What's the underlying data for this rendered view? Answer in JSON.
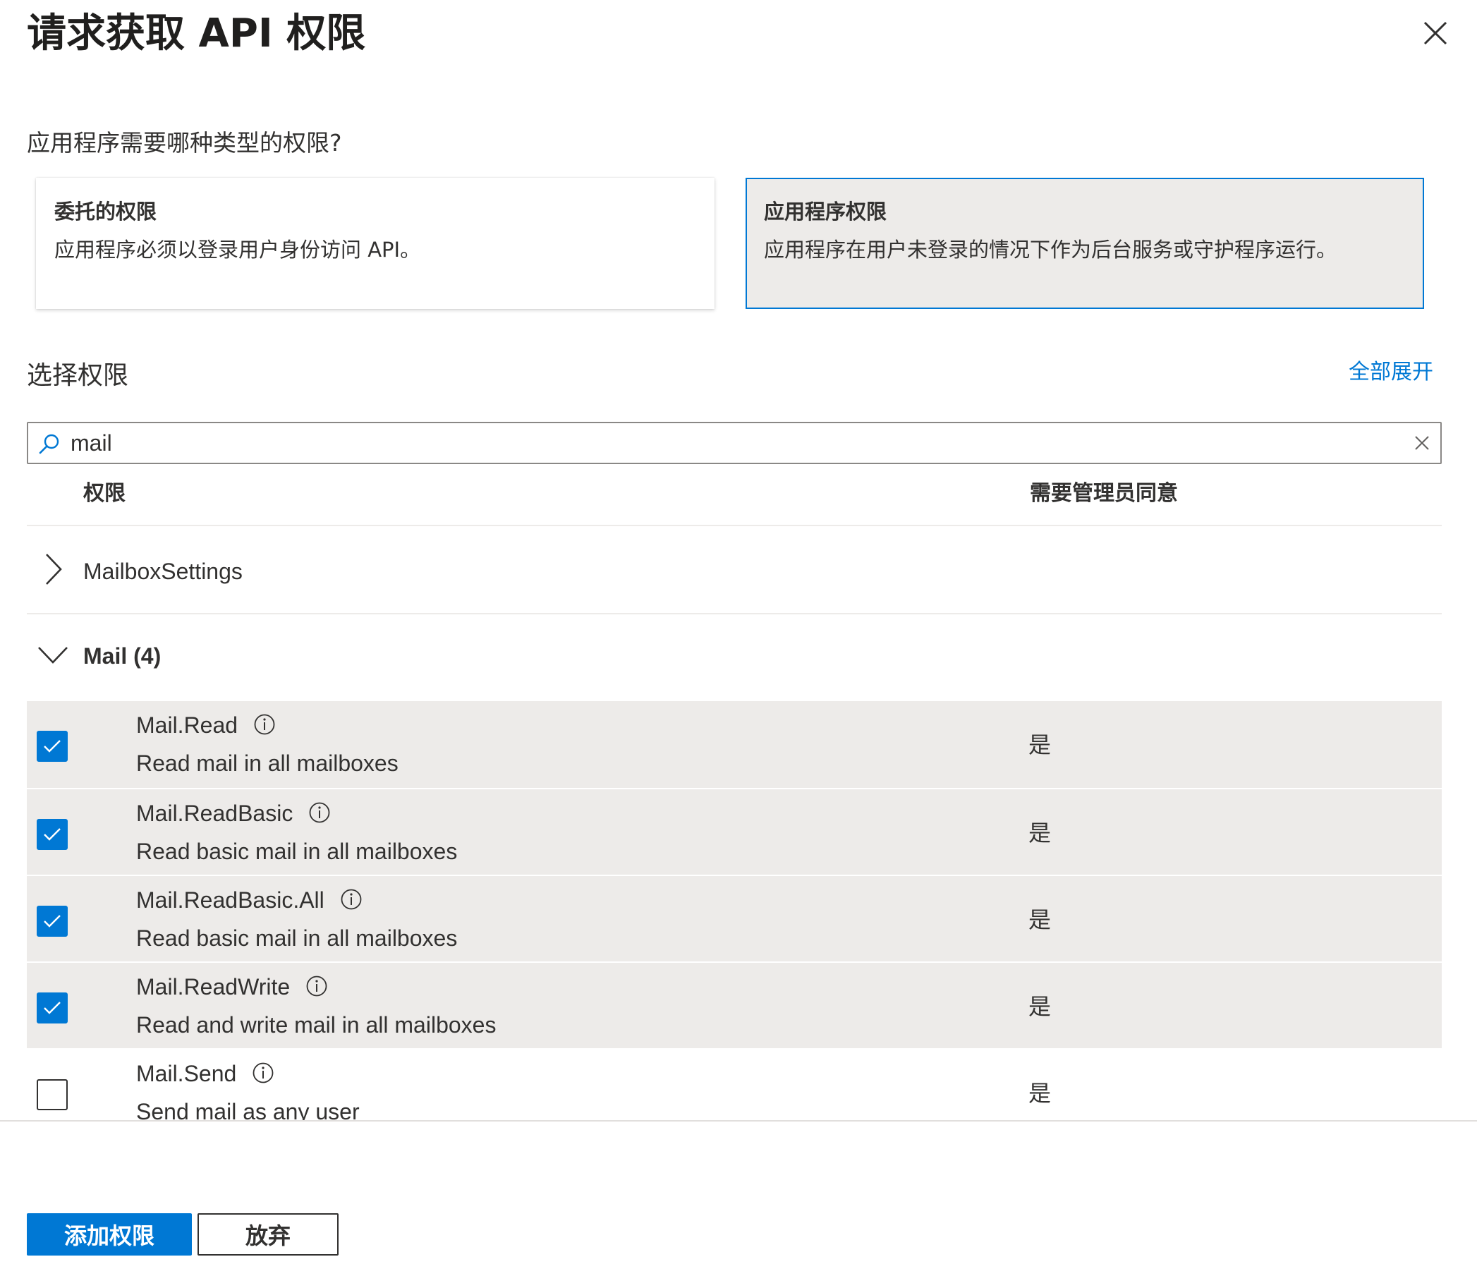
{
  "header": {
    "title": "请求获取 API 权限",
    "close_icon": "close-icon"
  },
  "question": "应用程序需要哪种类型的权限?",
  "permission_types": [
    {
      "title": "委托的权限",
      "description": "应用程序必须以登录用户身份访问 API。",
      "selected": false
    },
    {
      "title": "应用程序权限",
      "description": "应用程序在用户未登录的情况下作为后台服务或守护程序运行。",
      "selected": true
    }
  ],
  "select_section": {
    "title": "选择权限",
    "expand_all": "全部展开"
  },
  "search": {
    "value": "mail",
    "icon": "search-icon",
    "clear_icon": "clear-icon"
  },
  "table": {
    "columns": [
      "权限",
      "需要管理员同意"
    ]
  },
  "groups": [
    {
      "label": "MailboxSettings",
      "expanded": false
    },
    {
      "label": "Mail (4)",
      "expanded": true,
      "permissions": [
        {
          "name": "Mail.Read",
          "description": "Read mail in all mailboxes",
          "admin_consent": "是",
          "checked": true
        },
        {
          "name": "Mail.ReadBasic",
          "description": "Read basic mail in all mailboxes",
          "admin_consent": "是",
          "checked": true
        },
        {
          "name": "Mail.ReadBasic.All",
          "description": "Read basic mail in all mailboxes",
          "admin_consent": "是",
          "checked": true
        },
        {
          "name": "Mail.ReadWrite",
          "description": "Read and write mail in all mailboxes",
          "admin_consent": "是",
          "checked": true
        },
        {
          "name": "Mail.Send",
          "description": "Send mail as any user",
          "admin_consent": "是",
          "checked": false
        }
      ]
    }
  ],
  "footer": {
    "add_button": "添加权限",
    "discard_button": "放弃"
  },
  "colors": {
    "accent": "#0078d4",
    "selected_bg": "#edebe9",
    "text": "#323130"
  }
}
